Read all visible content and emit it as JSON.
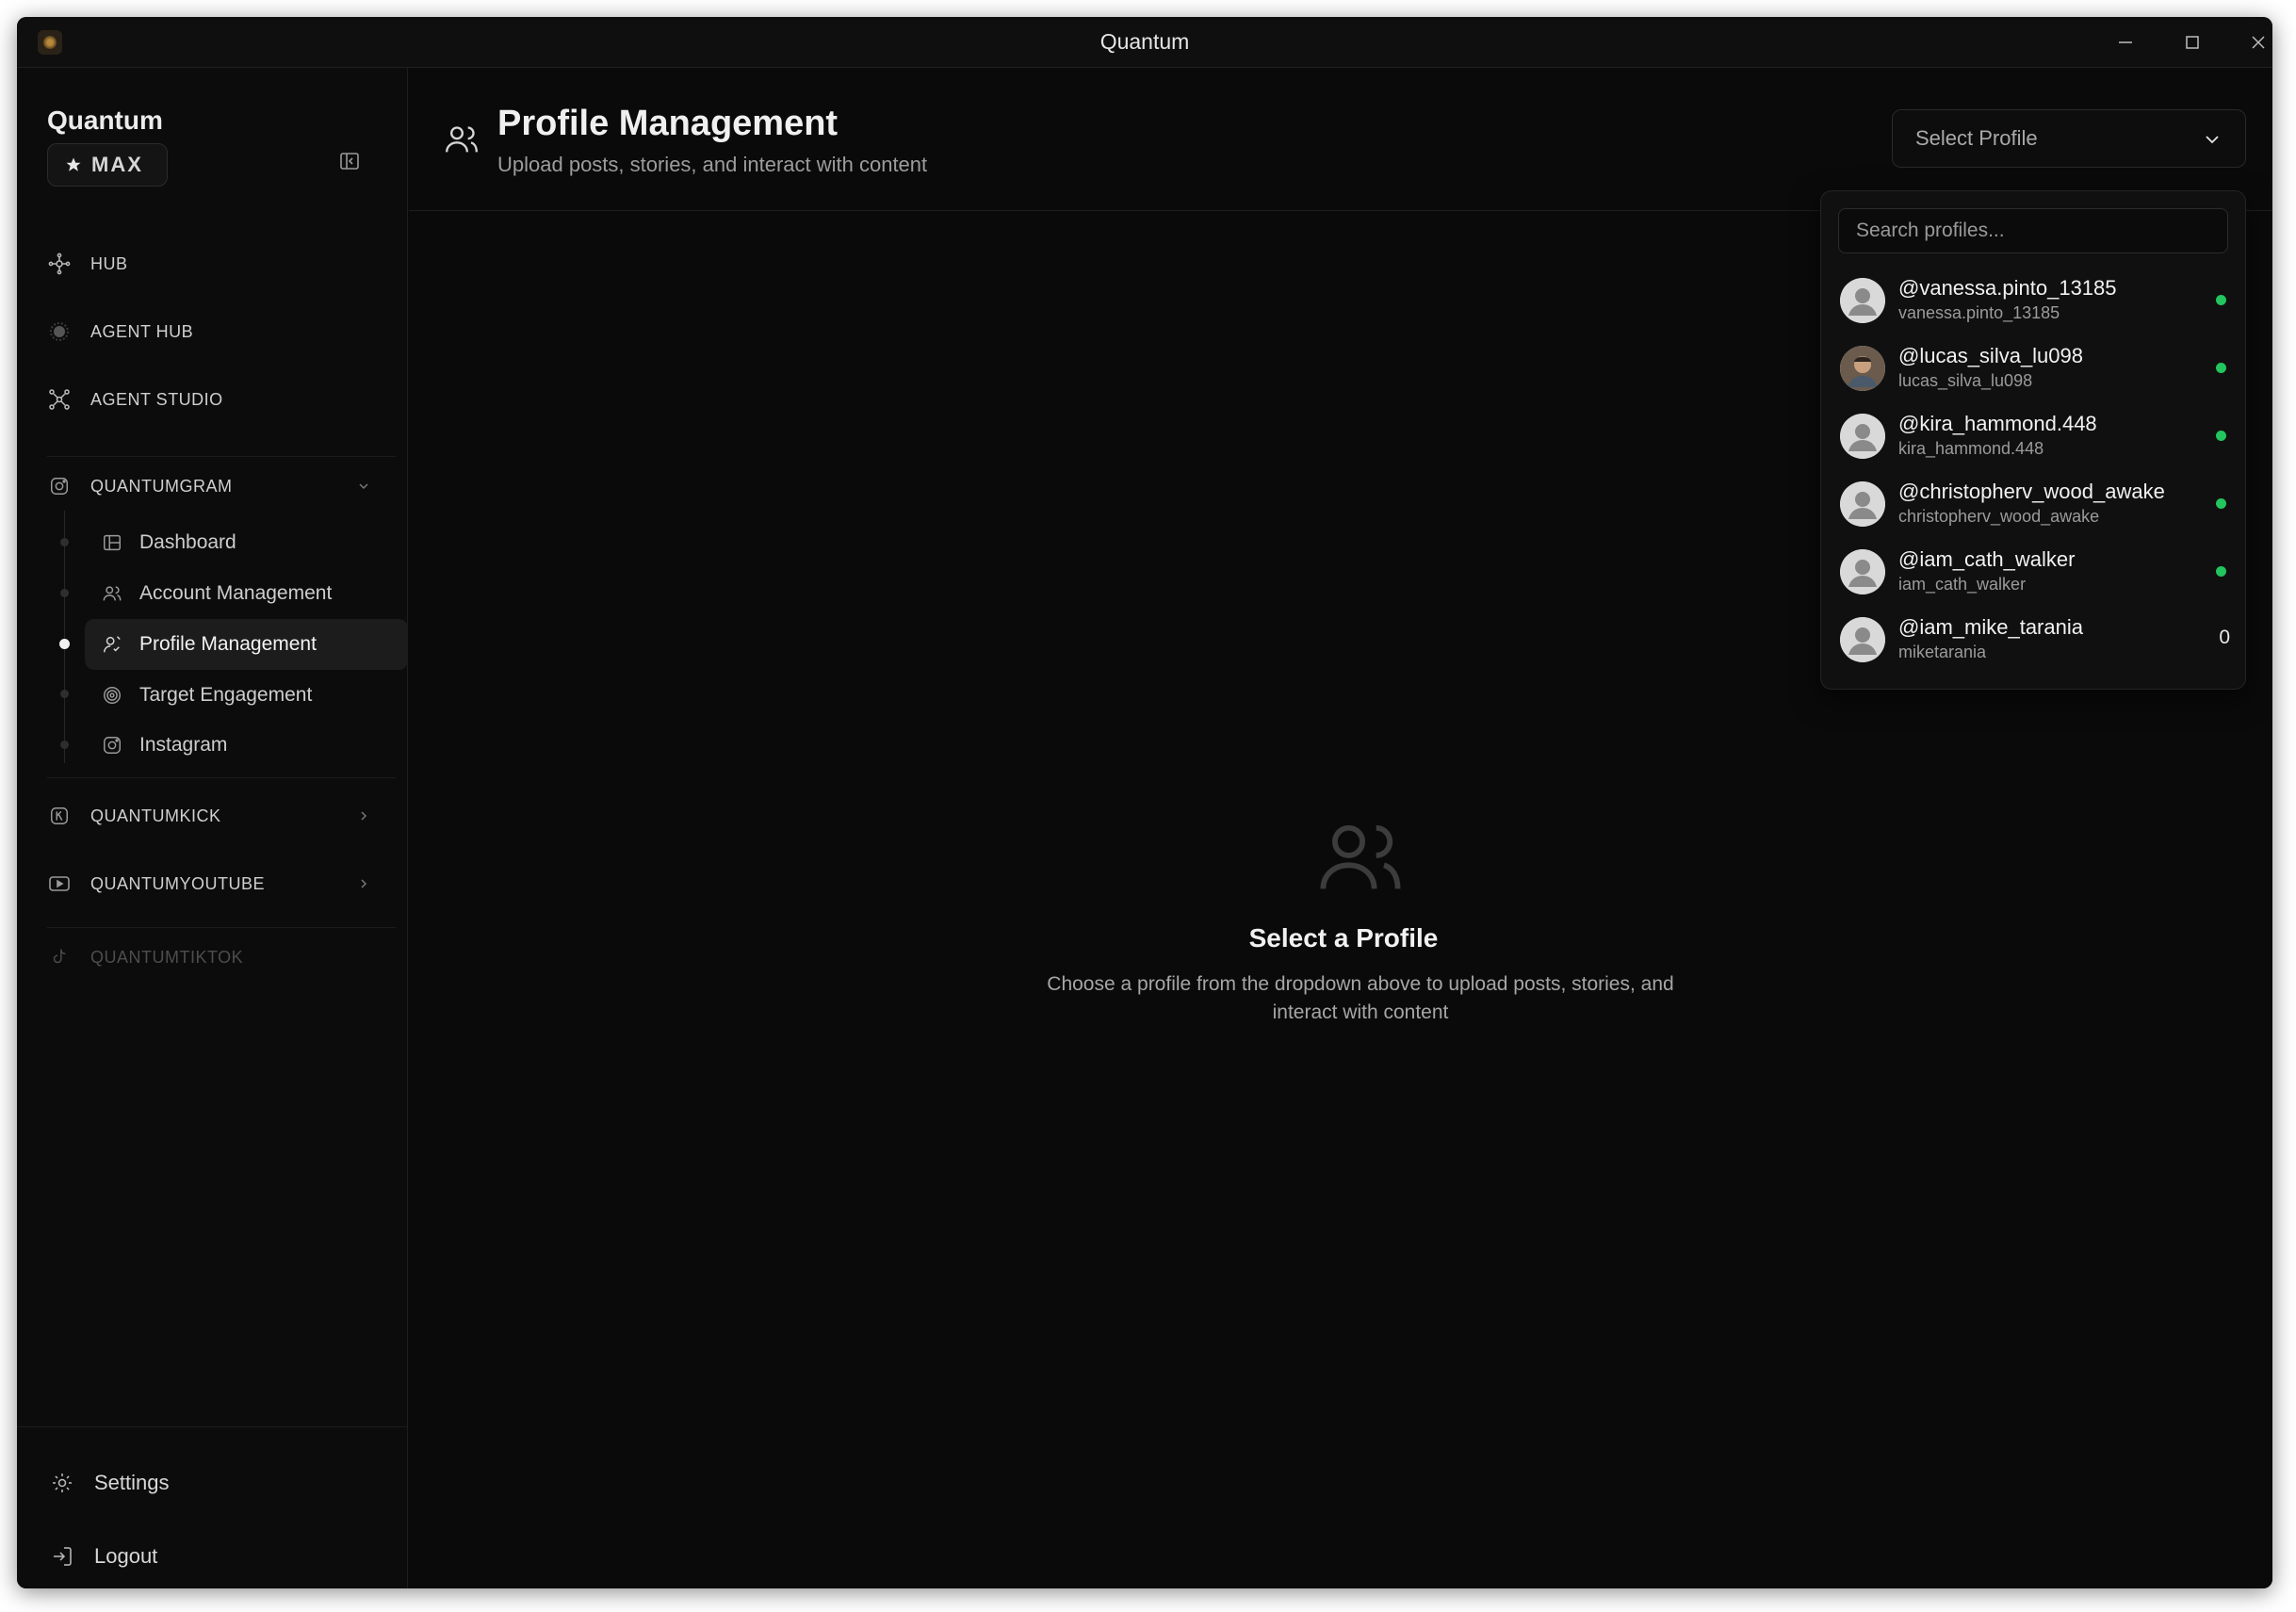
{
  "window": {
    "title": "Quantum"
  },
  "sidebar": {
    "brand": "Quantum",
    "badge": "MAX",
    "nav": [
      {
        "label": "HUB",
        "icon": "hub-icon"
      },
      {
        "label": "AGENT HUB",
        "icon": "agent-hub-icon"
      },
      {
        "label": "AGENT STUDIO",
        "icon": "agent-studio-icon"
      }
    ],
    "sections": {
      "quantumgram": "QUANTUMGRAM",
      "quantumkick": "QUANTUMKICK",
      "quantumyoutube": "QUANTUMYOUTUBE",
      "quantumtiktok": "QUANTUMTIKTOK"
    },
    "sub_items": [
      {
        "label": "Dashboard",
        "icon": "dashboard-icon"
      },
      {
        "label": "Account Management",
        "icon": "users-icon"
      },
      {
        "label": "Profile Management",
        "icon": "profile-icon",
        "active": true
      },
      {
        "label": "Target Engagement",
        "icon": "target-icon"
      },
      {
        "label": "Instagram",
        "icon": "instagram-icon"
      }
    ],
    "bottom": {
      "settings": "Settings",
      "logout": "Logout"
    }
  },
  "header": {
    "title": "Profile Management",
    "subtitle": "Upload posts, stories, and interact with content"
  },
  "profile_select": {
    "value": "Select Profile",
    "search_placeholder": "Search profiles...",
    "options": [
      {
        "handle": "@vanessa.pinto_13185",
        "username": "vanessa.pinto_13185",
        "status": "online"
      },
      {
        "handle": "@lucas_silva_lu098",
        "username": "lucas_silva_lu098",
        "status": "online"
      },
      {
        "handle": "@kira_hammond.448",
        "username": "kira_hammond.448",
        "status": "online"
      },
      {
        "handle": "@christopherv_wood_awake",
        "username": "christopherv_wood_awake",
        "status": "online"
      },
      {
        "handle": "@iam_cath_walker",
        "username": "iam_cath_walker",
        "status": "online"
      },
      {
        "handle": "@iam_mike_tarania",
        "username": "miketarania",
        "count": "0"
      }
    ]
  },
  "empty_state": {
    "title": "Select a Profile",
    "text": "Choose a profile from the dropdown above to upload posts, stories, and interact with content"
  },
  "colors": {
    "status_online": "#22c55e",
    "background": "#0a0a0a"
  }
}
